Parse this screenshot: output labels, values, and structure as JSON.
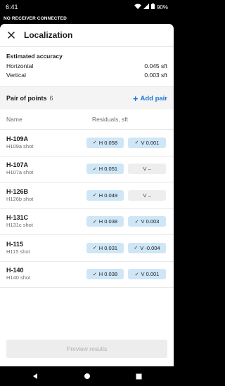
{
  "status_bar": {
    "time": "6:41",
    "battery": "90%"
  },
  "banner": "NO RECEIVER CONNECTED",
  "appbar": {
    "title": "Localization"
  },
  "accuracy": {
    "heading": "Estimated accuracy",
    "horizontal_label": "Horizontal",
    "horizontal_value": "0.045 sft",
    "vertical_label": "Vertical",
    "vertical_value": "0.003 sft"
  },
  "pairs": {
    "label": "Pair of points",
    "count": "6",
    "add_label": "Add pair"
  },
  "columns": {
    "name": "Name",
    "residuals": "Residuals, sft"
  },
  "rows": [
    {
      "name": "H-109A",
      "sub": "H109a shot",
      "h": "H 0.058",
      "v": "V 0.001",
      "v_on": true
    },
    {
      "name": "H-107A",
      "sub": "H107a shot",
      "h": "H 0.051",
      "v": "V –",
      "v_on": false
    },
    {
      "name": "H-126B",
      "sub": "H126b shot",
      "h": "H 0.049",
      "v": "V –",
      "v_on": false
    },
    {
      "name": "H-131C",
      "sub": "H131c shot",
      "h": "H 0.038",
      "v": "V 0.003",
      "v_on": true
    },
    {
      "name": "H-115",
      "sub": "H115 shot",
      "h": "H 0.031",
      "v": "V -0.004",
      "v_on": true
    },
    {
      "name": "H-140",
      "sub": "H140 shot",
      "h": "H 0.038",
      "v": "V 0.001",
      "v_on": true
    }
  ],
  "footer": {
    "preview_label": "Preview results"
  }
}
